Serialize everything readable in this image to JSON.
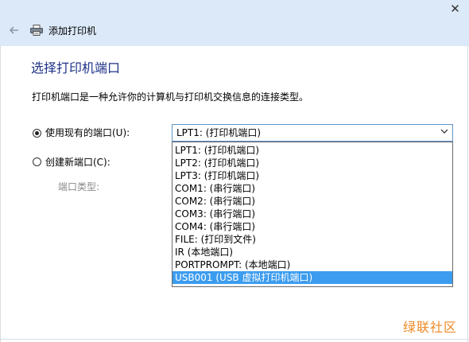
{
  "window": {
    "title": "添加打印机",
    "close_symbol": "✕"
  },
  "page": {
    "heading": "选择打印机端口",
    "description": "打印机端口是一种允许你的计算机与打印机交换信息的连接类型。"
  },
  "options": {
    "use_existing": {
      "label": "使用现有的端口(U):",
      "selected": true
    },
    "create_new": {
      "label": "创建新端口(C):",
      "selected": false
    },
    "port_type_label": "端口类型:"
  },
  "port_select": {
    "value": "LPT1: (打印机端口)",
    "items": [
      "LPT1: (打印机端口)",
      "LPT2: (打印机端口)",
      "LPT3: (打印机端口)",
      "COM1: (串行端口)",
      "COM2: (串行端口)",
      "COM3: (串行端口)",
      "COM4: (串行端口)",
      "FILE: (打印到文件)",
      "IR (本地端口)",
      "PORTPROMPT: (本地端口)",
      "USB001 (USB 虚拟打印机端口)"
    ],
    "highlighted_index": 10
  },
  "watermark": "绿联社区",
  "icons": {
    "back": "arrow-left-icon",
    "printer": "printer-icon",
    "dropdown": "chevron-down-icon",
    "close": "close-icon"
  },
  "colors": {
    "titlebar": "#dbe9f8",
    "heading": "#1e3287",
    "selection": "#3c9cef",
    "watermark": "#f08a24"
  }
}
